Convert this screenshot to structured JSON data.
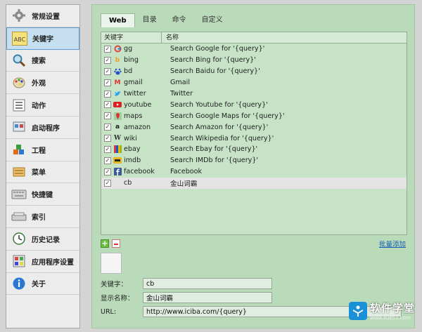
{
  "sidebar": {
    "items": [
      {
        "label": "常规设置",
        "icon": "gear-icon"
      },
      {
        "label": "关键字",
        "icon": "abc-icon",
        "active": true
      },
      {
        "label": "搜索",
        "icon": "magnifier-icon"
      },
      {
        "label": "外观",
        "icon": "palette-icon"
      },
      {
        "label": "动作",
        "icon": "list-icon"
      },
      {
        "label": "启动程序",
        "icon": "launcher-icon"
      },
      {
        "label": "工程",
        "icon": "blocks-icon"
      },
      {
        "label": "菜单",
        "icon": "menu-icon"
      },
      {
        "label": "快捷键",
        "icon": "keyboard-icon"
      },
      {
        "label": "索引",
        "icon": "index-icon"
      },
      {
        "label": "历史记录",
        "icon": "clock-icon"
      },
      {
        "label": "应用程序设置",
        "icon": "app-settings-icon"
      },
      {
        "label": "关于",
        "icon": "info-icon"
      }
    ]
  },
  "tabs": [
    {
      "label": "Web",
      "active": true
    },
    {
      "label": "目录"
    },
    {
      "label": "命令"
    },
    {
      "label": "自定义"
    }
  ],
  "table": {
    "col_keyword": "关键字",
    "col_name": "名称",
    "rows": [
      {
        "keyword": "gg",
        "name": "Search Google for '{query}'",
        "icon": "google-icon"
      },
      {
        "keyword": "bing",
        "name": "Search Bing for '{query}'",
        "icon": "bing-icon"
      },
      {
        "keyword": "bd",
        "name": "Search Baidu for '{query}'",
        "icon": "baidu-icon"
      },
      {
        "keyword": "gmail",
        "name": "Gmail",
        "icon": "gmail-icon"
      },
      {
        "keyword": "twitter",
        "name": "Twitter",
        "icon": "twitter-icon"
      },
      {
        "keyword": "youtube",
        "name": "Search Youtube for '{query}'",
        "icon": "youtube-icon"
      },
      {
        "keyword": "maps",
        "name": "Search Google Maps for '{query}'",
        "icon": "maps-icon"
      },
      {
        "keyword": "amazon",
        "name": "Search Amazon for '{query}'",
        "icon": "amazon-icon"
      },
      {
        "keyword": "wiki",
        "name": "Search Wikipedia for '{query}'",
        "icon": "wikipedia-icon"
      },
      {
        "keyword": "ebay",
        "name": "Search Ebay for '{query}'",
        "icon": "ebay-icon"
      },
      {
        "keyword": "imdb",
        "name": "Search IMDb for '{query}'",
        "icon": "imdb-icon"
      },
      {
        "keyword": "facebook",
        "name": "Facebook",
        "icon": "facebook-icon"
      },
      {
        "keyword": "cb",
        "name": "金山词霸",
        "icon": "",
        "selected": true
      }
    ]
  },
  "controls": {
    "add": "+",
    "batch_add": "批量添加"
  },
  "form": {
    "keyword_label": "关键字：",
    "keyword_value": "cb",
    "display_label": "显示名称：",
    "display_value": "金山词霸",
    "url_label": "URL:",
    "url_value": "http://www.iciba.com/{query}"
  },
  "watermark": {
    "cn": "软件学堂",
    "url": "www.xue51.com"
  },
  "colors": {
    "panel_bg": "#b9dbb9",
    "table_bg": "#c6e3c6",
    "selected_row": "#e4e4e4",
    "active_sidebar": "#c5dff0",
    "link": "#1a5fb4"
  }
}
